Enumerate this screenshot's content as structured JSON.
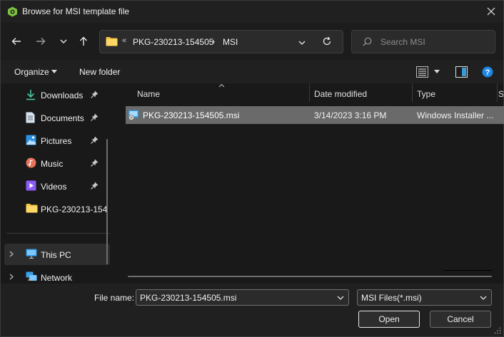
{
  "window": {
    "title": "Browse for MSI template file"
  },
  "nav": {
    "back_icon": "arrow-left-icon",
    "forward_icon": "arrow-right-icon",
    "recent_icon": "chevron-down-icon",
    "up_icon": "arrow-up-icon"
  },
  "address": {
    "overflow": "«",
    "crumbs": [
      "PKG-230213-154505",
      "MSI"
    ],
    "separator": "›"
  },
  "search": {
    "placeholder": "Search MSI"
  },
  "commandbar": {
    "organize": "Organize",
    "new_folder": "New folder"
  },
  "sidebar": {
    "items": [
      {
        "label": "Downloads",
        "icon": "download-icon",
        "pinned": true
      },
      {
        "label": "Documents",
        "icon": "document-icon",
        "pinned": true
      },
      {
        "label": "Pictures",
        "icon": "pictures-icon",
        "pinned": true
      },
      {
        "label": "Music",
        "icon": "music-icon",
        "pinned": true
      },
      {
        "label": "Videos",
        "icon": "videos-icon",
        "pinned": true
      },
      {
        "label": "PKG-230213-154",
        "icon": "folder-icon",
        "pinned": false
      },
      {
        "label": "This PC",
        "icon": "computer-icon",
        "selected": true
      },
      {
        "label": "Network",
        "icon": "network-icon"
      }
    ]
  },
  "filelist": {
    "columns": [
      "Name",
      "Date modified",
      "Type",
      "S"
    ],
    "rows": [
      {
        "name": "PKG-230213-154505.msi",
        "date": "3/14/2023 3:16 PM",
        "type": "Windows Installer ..."
      }
    ]
  },
  "footer": {
    "filename_label": "File name:",
    "filename_value": "PKG-230213-154505.msi",
    "filter_value": "MSI Files(*.msi)",
    "open_label": "Open",
    "cancel_label": "Cancel"
  },
  "colors": {
    "background": "#191919",
    "selected_row": "#6a6a6a",
    "help_blue": "#1e88e5",
    "folder_yellow": "#f5c242",
    "app_icon_green": "#7cc242"
  }
}
